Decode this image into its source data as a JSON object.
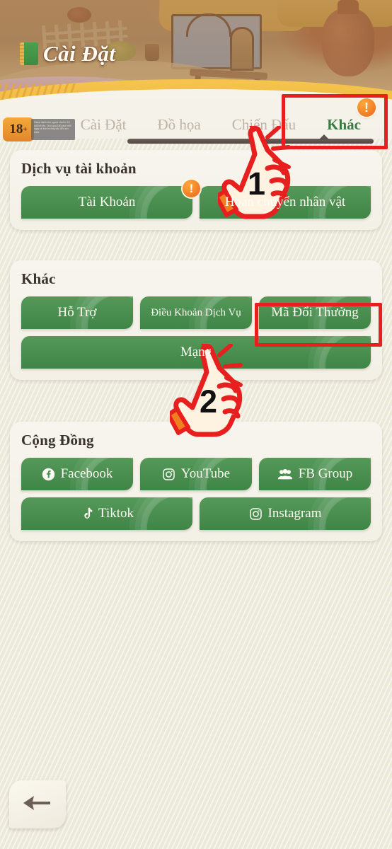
{
  "header": {
    "title": "Cài Đặt",
    "icon": "notebook-icon"
  },
  "age_rating": {
    "label": "18",
    "plus": "+",
    "note": "Game dành cho người chơi từ 18 tuổi trở lên. Chơi quá 180 phút mỗi ngày sẽ ảnh hưởng xấu đến sức khỏe."
  },
  "tabs": [
    {
      "label": "Cài Đặt",
      "active": false
    },
    {
      "label": "Đồ họa",
      "active": false
    },
    {
      "label": "Chiến Đấu",
      "active": false
    },
    {
      "label": "Khác",
      "active": true
    }
  ],
  "tab_badge": "!",
  "sections": [
    {
      "title": "Dịch vụ tài khoản",
      "rows": [
        [
          {
            "label": "Tài Khoản",
            "icon": null,
            "badge": "!",
            "small": false
          },
          {
            "label": "Hoán chuyển nhân vật",
            "icon": null,
            "badge": null,
            "small": false
          }
        ]
      ]
    },
    {
      "title": "Khác",
      "rows": [
        [
          {
            "label": "Hỗ Trợ",
            "icon": null,
            "badge": null,
            "small": false
          },
          {
            "label": "Điều Khoản Dịch Vụ",
            "icon": null,
            "badge": null,
            "small": true
          },
          {
            "label": "Mã Đổi Thưởng",
            "icon": null,
            "badge": null,
            "small": false
          }
        ],
        [
          {
            "label": "Mạng",
            "icon": null,
            "badge": null,
            "small": false
          }
        ]
      ]
    },
    {
      "title": "Cộng Đồng",
      "rows": [
        [
          {
            "label": "Facebook",
            "icon": "facebook-icon",
            "badge": null,
            "small": false
          },
          {
            "label": "YouTube",
            "icon": "youtube-icon",
            "badge": null,
            "small": false
          },
          {
            "label": "FB Group",
            "icon": "fb-group-icon",
            "badge": null,
            "small": false
          }
        ],
        [
          {
            "label": "Tiktok",
            "icon": "tiktok-icon",
            "badge": null,
            "small": false
          },
          {
            "label": "Instagram",
            "icon": "instagram-icon",
            "badge": null,
            "small": false
          }
        ]
      ]
    }
  ],
  "back_button": {
    "icon": "arrow-left-icon"
  },
  "annotations": {
    "step1": "1",
    "step2": "2",
    "box1_target": "Khác",
    "box2_target": "Mã Đổi Thưởng"
  },
  "colors": {
    "green": "#4a9150",
    "accent_orange": "#e9661d",
    "annotation_red": "#e81f1f",
    "page_bg": "#ece8da",
    "card_bg": "#f7f5ee",
    "gold": "#f0bd42"
  }
}
